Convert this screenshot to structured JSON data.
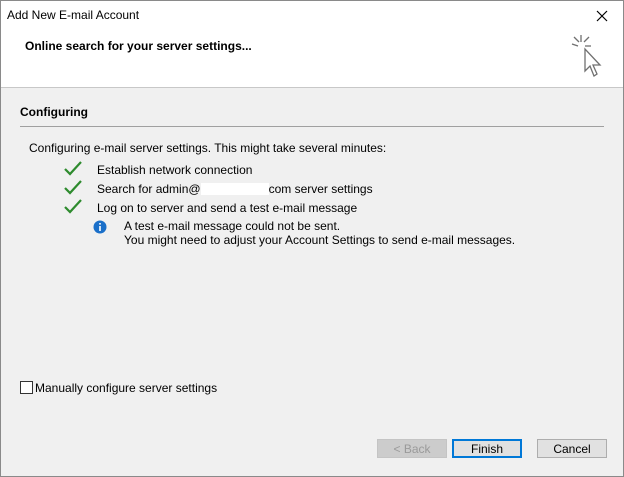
{
  "window": {
    "title": "Add New E-mail Account"
  },
  "header": {
    "title": "Online search for your server settings...",
    "icon": "cursor-sparkle-icon"
  },
  "section": {
    "title": "Configuring",
    "intro": "Configuring e-mail server settings. This might take several minutes:"
  },
  "steps": [
    {
      "label": "Establish network connection",
      "status": "done"
    },
    {
      "label_prefix": "Search for admin@",
      "label_suffix": "com server settings",
      "status": "done"
    },
    {
      "label": "Log on to server and send a test e-mail message",
      "status": "done"
    }
  ],
  "info": {
    "line1": "A test e-mail message could not be sent.",
    "line2": "You might need to adjust your Account Settings to send e-mail messages."
  },
  "manual_config": {
    "label": "Manually configure server settings",
    "checked": false
  },
  "buttons": {
    "back": "< Back",
    "finish": "Finish",
    "cancel": "Cancel"
  },
  "colors": {
    "check": "#2e8b2e",
    "info": "#1a6fc9",
    "accent": "#0078d7"
  }
}
